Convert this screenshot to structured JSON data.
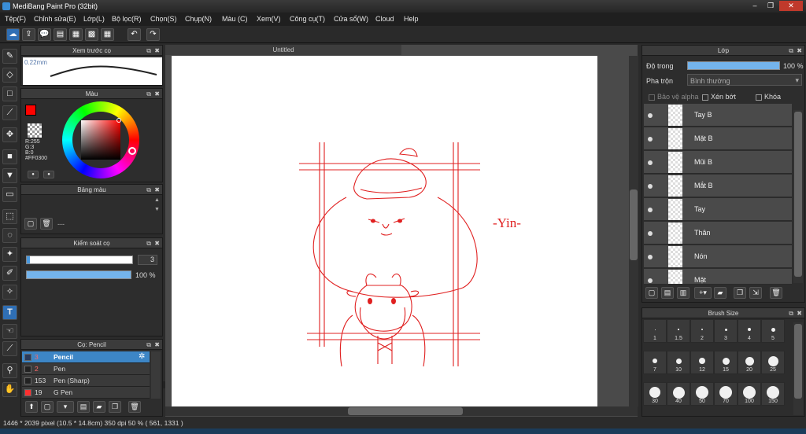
{
  "window": {
    "title": "MediBang Paint Pro (32bit)",
    "min": "–",
    "restore": "❐",
    "close": "✕"
  },
  "menu": [
    "Tệp(F)",
    "Chỉnh sửa(E)",
    "Lớp(L)",
    "Bộ lọc(R)",
    "Chọn(S)",
    "Chụp(N)",
    "Màu (C)",
    "Xem(V)",
    "Công cụ(T)",
    "Cửa sổ(W)",
    "Cloud",
    "Help"
  ],
  "brush_preview": {
    "title": "Xem trước cọ",
    "size_label": "0.22mm"
  },
  "color_panel": {
    "title": "Màu",
    "r": "R:255",
    "g": "G:3",
    "b": "B:0",
    "hex": "#FF0300",
    "primary_color": "#ff0300"
  },
  "palette": {
    "title": "Bảng màu",
    "label": "---",
    "colors_row1": [
      "#3a8ed8",
      "#2d6cc0",
      "#222222",
      "#ffffff",
      "#7a1a1a",
      "#c0c0c0",
      "#ff8040",
      "#4aa84a",
      "#2a7a2a",
      "#aa2222",
      "#444444",
      "#888888",
      "#ff5555",
      "#ffc8a0",
      "#f0f0f0",
      "#ff3030",
      "#222222"
    ],
    "colors_row2": [
      "#f5e6c8",
      "#ffff40",
      "#dddddd",
      "#ff8a40",
      "#cc33ff",
      "#ff3333"
    ]
  },
  "brush_control": {
    "title": "Kiểm soát cọ",
    "size": "3",
    "opacity": "100 %",
    "opacity_fraction": 1.0
  },
  "brush_list": {
    "title": "Cọ: Pencil",
    "items": [
      {
        "num": "3",
        "name": "Pencil",
        "color": "#2a3a5a",
        "selected": true
      },
      {
        "num": "2",
        "name": "Pen",
        "color": "#222222",
        "selected": false
      },
      {
        "num": "153",
        "name": "Pen (Sharp)",
        "color": "#222222",
        "selected": false
      },
      {
        "num": "19",
        "name": "G Pen",
        "color": "#ff3030",
        "selected": false
      }
    ]
  },
  "document": {
    "tab": "Untitled",
    "signature": "-Yin-"
  },
  "layer_panel": {
    "title": "Lớp",
    "opacity_label": "Độ trong",
    "opacity_value": "100 %",
    "opacity_fraction": 1.0,
    "blend_label": "Pha trộn",
    "blend_value": "Bình thường",
    "protect_alpha": "Bảo vệ alpha",
    "clipping": "Xén bớt",
    "lock": "Khóa",
    "layers": [
      "Tay B",
      "Mặt B",
      "Mũi B",
      "Mắt B",
      "Tay",
      "Thân",
      "Nón",
      "Mặt"
    ]
  },
  "brush_size": {
    "title": "Brush Size",
    "sizes": [
      "1",
      "1.5",
      "2",
      "3",
      "4",
      "5",
      "7",
      "10",
      "12",
      "15",
      "20",
      "25",
      "30",
      "40",
      "50",
      "70",
      "100",
      "150"
    ]
  },
  "status": {
    "text": "1446 * 2039 pixel  (10.5 * 14.8cm)  350 dpi  50 %  ( 561, 1331 )"
  }
}
